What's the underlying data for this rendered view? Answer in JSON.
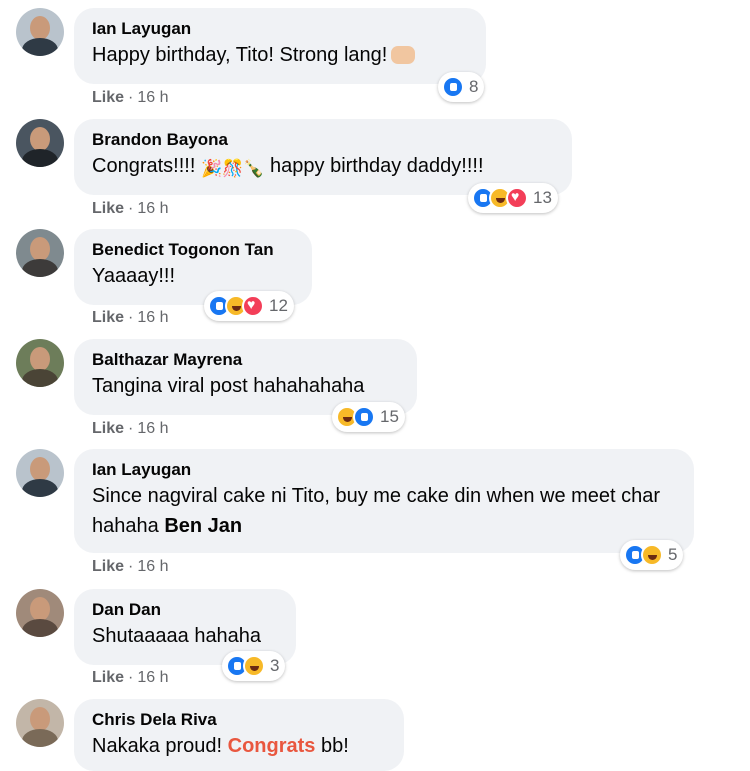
{
  "comments": [
    {
      "author": "Ian Layugan",
      "text": "Happy birthday, Tito! Strong lang!",
      "emoji_icon": "flexed-fist-emoji",
      "like_label": "Like",
      "time": "16 h",
      "reactions": [
        "like"
      ],
      "reaction_count": "8"
    },
    {
      "author": "Brandon Bayona",
      "text_prefix": "Congrats!!!!",
      "emojis": "🎉🎊🍾",
      "text_suffix": "happy birthday daddy!!!!",
      "like_label": "Like",
      "time": "16 h",
      "reactions": [
        "like",
        "haha",
        "love"
      ],
      "reaction_count": "13"
    },
    {
      "author": "Benedict Togonon Tan",
      "text": "Yaaaay!!!",
      "like_label": "Like",
      "time": "16 h",
      "reactions": [
        "like",
        "haha",
        "love"
      ],
      "reaction_count": "12"
    },
    {
      "author": "Balthazar Mayrena",
      "text": "Tangina viral post hahahahaha",
      "like_label": "Like",
      "time": "16 h",
      "reactions": [
        "haha",
        "like"
      ],
      "reaction_count": "15"
    },
    {
      "author": "Ian Layugan",
      "text": "Since nagviral cake ni Tito, buy me cake din when we meet char hahaha",
      "mention": "Ben Jan",
      "like_label": "Like",
      "time": "16 h",
      "reactions": [
        "like",
        "haha"
      ],
      "reaction_count": "5"
    },
    {
      "author": "Dan Dan",
      "text": "Shutaaaaa hahaha",
      "like_label": "Like",
      "time": "16 h",
      "reactions": [
        "like",
        "haha"
      ],
      "reaction_count": "3"
    },
    {
      "author": "Chris Dela Riva",
      "text_prefix": "Nakaka proud!",
      "highlight": "Congrats",
      "text_suffix": "bb!"
    }
  ],
  "colors": {
    "bubble": "#f0f2f5",
    "meta_text": "#65676b",
    "like_blue": "#1877f2",
    "haha_yellow": "#f7b928",
    "love_red": "#f33e58",
    "highlight_orange": "#e9573f"
  }
}
